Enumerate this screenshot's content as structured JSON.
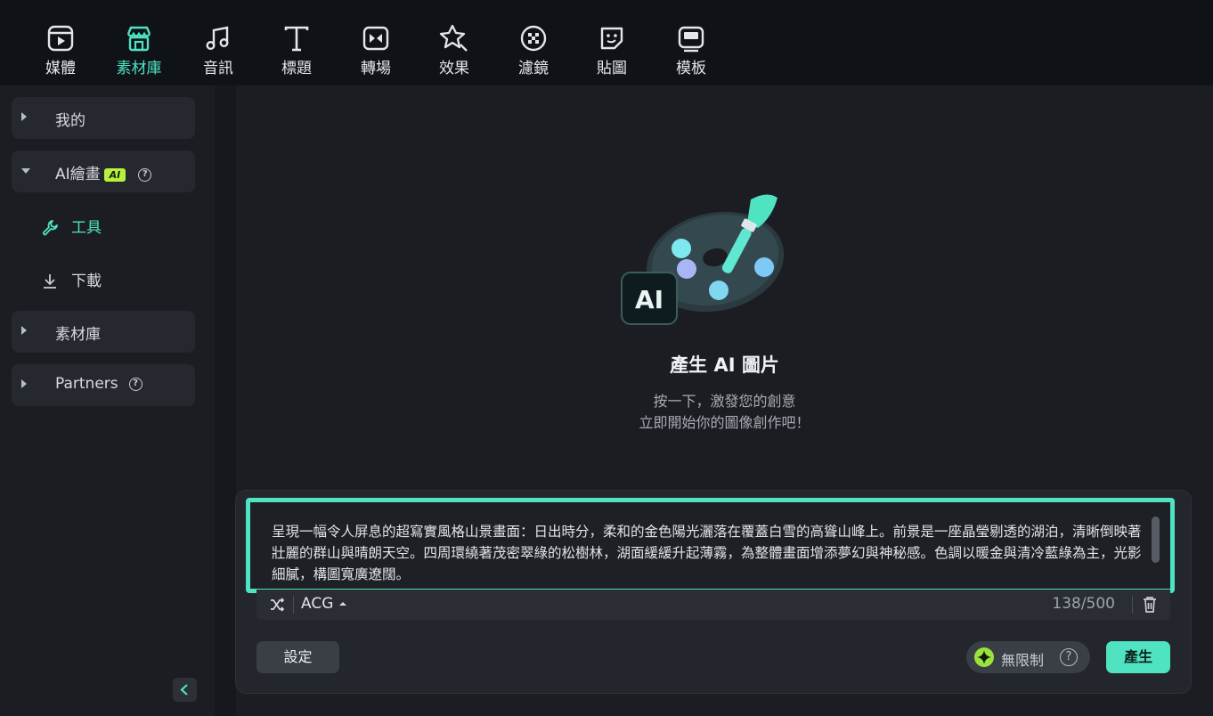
{
  "toolbar": {
    "items": [
      {
        "label": "媒體",
        "icon": "media-icon"
      },
      {
        "label": "素材庫",
        "icon": "store-icon"
      },
      {
        "label": "音訊",
        "icon": "music-note-icon"
      },
      {
        "label": "標題",
        "icon": "title-t-icon"
      },
      {
        "label": "轉場",
        "icon": "transition-icon"
      },
      {
        "label": "效果",
        "icon": "effects-star-icon"
      },
      {
        "label": "濾鏡",
        "icon": "filter-icon"
      },
      {
        "label": "貼圖",
        "icon": "sticker-icon"
      },
      {
        "label": "模板",
        "icon": "template-icon"
      }
    ],
    "active_index": 1
  },
  "sidebar": {
    "my": "我的",
    "ai_paint": "AI繪畫",
    "ai_badge": "AI",
    "help_glyph": "?",
    "tools": "工具",
    "downloads": "下載",
    "library": "素材庫",
    "partners": "Partners"
  },
  "hero": {
    "title": "產生 AI 圖片",
    "line1": "按一下，激發您的創意",
    "line2": "立即開始你的圖像創作吧！",
    "art_label": "AI"
  },
  "prompt": {
    "text": "呈現一幅令人屏息的超寫實風格山景畫面：日出時分，柔和的金色陽光灑落在覆蓋白雪的高聳山峰上。前景是一座晶瑩剔透的湖泊，清晰倒映著壯麗的群山與晴朗天空。四周環繞著茂密翠綠的松樹林，湖面緩緩升起薄霧，為整體畫面增添夢幻與神秘感。色調以暖金與清冷藍綠為主，光影細膩，構圖寬廣遼闊。",
    "style": "ACG",
    "counter": "138/500"
  },
  "buttons": {
    "settings": "設定",
    "unlimited": "無限制",
    "generate": "產生"
  },
  "colors": {
    "accent": "#4fe3c1",
    "badge": "#b6f23c"
  }
}
